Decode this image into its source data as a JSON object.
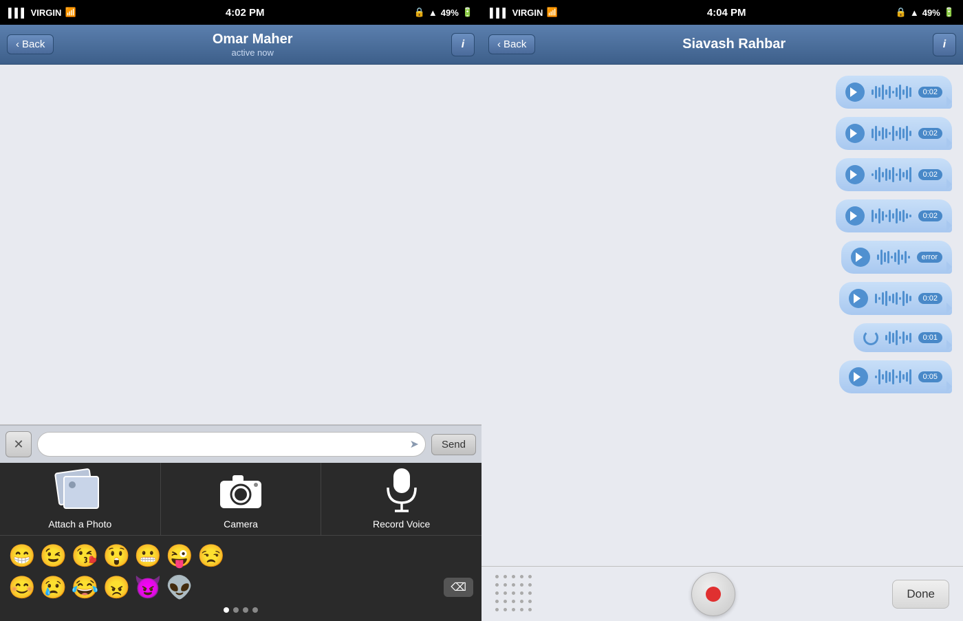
{
  "left_status_bar": {
    "carrier": "VIRGIN",
    "signal_bars": "▌▌▌",
    "wifi": "WiFi",
    "time": "4:02 PM",
    "lock": "🔒",
    "location": "▲",
    "battery": "49%"
  },
  "right_status_bar": {
    "carrier": "VIRGIN",
    "signal_bars": "▌▌▌",
    "wifi": "WiFi",
    "time": "4:04 PM",
    "lock": "🔒",
    "location": "▲",
    "battery": "49%"
  },
  "left_nav": {
    "back_label": "Back",
    "contact_name": "Omar Maher",
    "contact_status": "active now",
    "info_label": "i"
  },
  "right_nav": {
    "back_label": "Back",
    "contact_name": "Siavash Rahbar",
    "info_label": "i"
  },
  "input_bar": {
    "close_label": "✕",
    "placeholder": "",
    "send_label": "Send"
  },
  "attachment": {
    "photo_label": "Attach a Photo",
    "camera_label": "Camera",
    "voice_label": "Record Voice"
  },
  "emojis_row1": [
    "😁",
    "😉",
    "😘",
    "😲",
    "😬",
    "😜",
    "😒"
  ],
  "emojis_row2": [
    "😊",
    "😢",
    "😂",
    "😠",
    "😈",
    "👽"
  ],
  "voice_messages": [
    {
      "time": "0:02",
      "type": "normal"
    },
    {
      "time": "0:02",
      "type": "normal"
    },
    {
      "time": "0:02",
      "type": "normal"
    },
    {
      "time": "0:02",
      "type": "normal"
    },
    {
      "time": "error",
      "type": "error"
    },
    {
      "time": "0:02",
      "type": "normal"
    },
    {
      "time": "0:01",
      "type": "loading"
    },
    {
      "time": "0:05",
      "type": "normal"
    }
  ],
  "recording_bar": {
    "done_label": "Done"
  }
}
